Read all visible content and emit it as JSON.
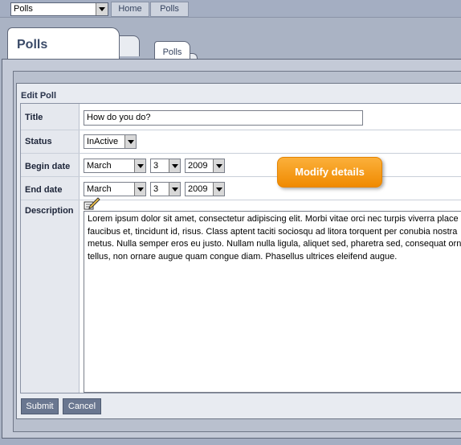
{
  "topbar": {
    "module_select_value": "Polls",
    "nav": [
      {
        "label": "Home"
      },
      {
        "label": "Polls"
      }
    ]
  },
  "tabs": {
    "main_title": "Polls",
    "sub_tab": "Polls"
  },
  "panel": {
    "title": "Edit Poll"
  },
  "form": {
    "title_label": "Title",
    "title_value": "How do you do?",
    "status_label": "Status",
    "status_value": "InActive",
    "begin_label": "Begin date",
    "begin_month": "March",
    "begin_day": "3",
    "begin_year": "2009",
    "end_label": "End date",
    "end_month": "March",
    "end_day": "3",
    "end_year": "2009",
    "description_label": "Description",
    "description_lines": [
      "Lorem ipsum dolor sit amet, consectetur adipiscing elit. Morbi vitae orci nec turpis viverra place",
      "faucibus et, tincidunt id, risus. Class aptent taciti sociosqu ad litora torquent per conubia nostra",
      "metus. Nulla semper eros eu justo. Nullam nulla ligula, aliquet sed, pharetra sed, consequat orna",
      "tellus, non ornare augue quam congue diam. Phasellus ultrices eleifend augue."
    ]
  },
  "buttons": {
    "submit": "Submit",
    "cancel": "Cancel"
  },
  "callout": {
    "text": "Modify details"
  },
  "colors": {
    "accent_orange": "#f5a01e",
    "button_bg": "#6a7790",
    "page_bg": "#aab3c4"
  },
  "icons": {
    "editor": "pencil-note-icon",
    "dropdown": "chevron-down-icon"
  }
}
